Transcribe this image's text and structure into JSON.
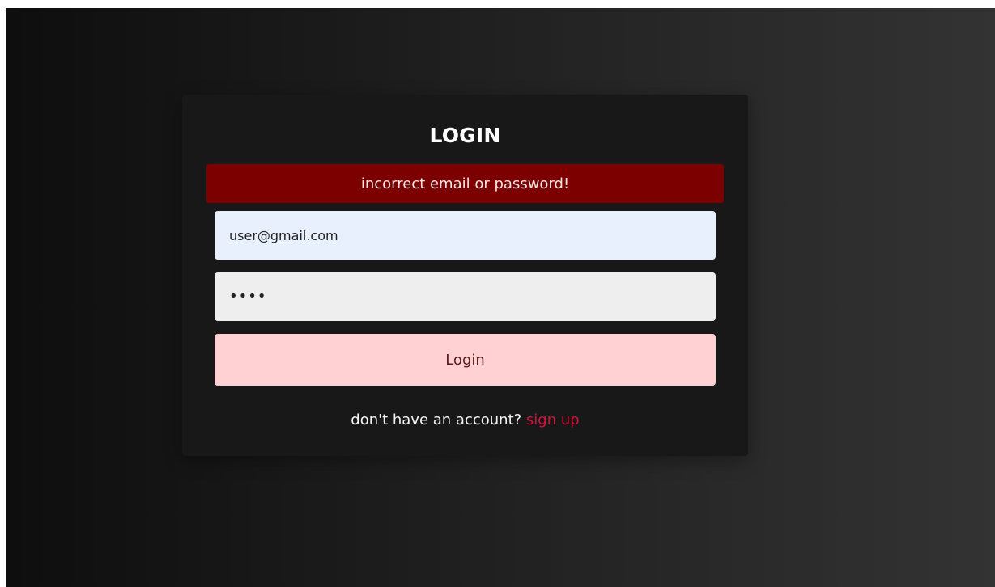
{
  "login": {
    "title": "LOGIN",
    "error_message": "incorrect email or password!",
    "email_value": "user@gmail.com",
    "password_masked": "••••",
    "submit_label": "Login",
    "signup_prompt": "don't have an account?",
    "signup_link": "sign up"
  },
  "colors": {
    "error_background": "#7d0000",
    "button_background": "#ffd1d3",
    "link_color": "#d4123a",
    "card_background": "#181818"
  }
}
